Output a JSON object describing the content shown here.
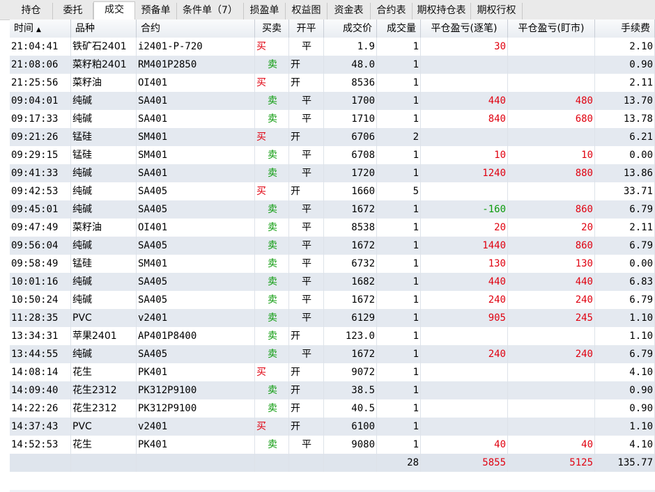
{
  "tabs": [
    "持仓",
    "委托",
    "成交",
    "预备单",
    "条件单（7）",
    "损盈单",
    "权益图",
    "资金表",
    "合约表",
    "期权持仓表",
    "期权行权"
  ],
  "active_tab": 2,
  "columns": [
    "时间",
    "品种",
    "合约",
    "买卖",
    "开平",
    "成交价",
    "成交量",
    "平仓盈亏(逐笔)",
    "平仓盈亏(盯市)",
    "手续费"
  ],
  "sort_icon": "sort-asc-icon",
  "colors": {
    "buy": "#e0000f",
    "sell": "#0a9a0a",
    "profit": "#e0000f",
    "loss": "#0a9a0a"
  },
  "trades": [
    {
      "time": "21:04:41",
      "product": "铁矿石2401",
      "contract": "i2401-P-720",
      "side": "买",
      "oc": "平",
      "price": "1.9",
      "qty": "1",
      "pnl_trade": "30",
      "pnl_mtm": "",
      "fee": "2.10"
    },
    {
      "time": "21:08:06",
      "product": "菜籽粕2401",
      "contract": "RM401P2850",
      "side": "卖",
      "oc": "开",
      "price": "48.0",
      "qty": "1",
      "pnl_trade": "",
      "pnl_mtm": "",
      "fee": "0.90"
    },
    {
      "time": "21:25:56",
      "product": "菜籽油",
      "contract": "OI401",
      "side": "买",
      "oc": "开",
      "price": "8536",
      "qty": "1",
      "pnl_trade": "",
      "pnl_mtm": "",
      "fee": "2.11"
    },
    {
      "time": "09:04:01",
      "product": "纯碱",
      "contract": "SA401",
      "side": "卖",
      "oc": "平",
      "price": "1700",
      "qty": "1",
      "pnl_trade": "440",
      "pnl_mtm": "480",
      "fee": "13.70"
    },
    {
      "time": "09:17:33",
      "product": "纯碱",
      "contract": "SA401",
      "side": "卖",
      "oc": "平",
      "price": "1710",
      "qty": "1",
      "pnl_trade": "840",
      "pnl_mtm": "680",
      "fee": "13.78"
    },
    {
      "time": "09:21:26",
      "product": "锰硅",
      "contract": "SM401",
      "side": "买",
      "oc": "开",
      "price": "6706",
      "qty": "2",
      "pnl_trade": "",
      "pnl_mtm": "",
      "fee": "6.21"
    },
    {
      "time": "09:29:15",
      "product": "锰硅",
      "contract": "SM401",
      "side": "卖",
      "oc": "平",
      "price": "6708",
      "qty": "1",
      "pnl_trade": "10",
      "pnl_mtm": "10",
      "fee": "0.00"
    },
    {
      "time": "09:41:33",
      "product": "纯碱",
      "contract": "SA401",
      "side": "卖",
      "oc": "平",
      "price": "1720",
      "qty": "1",
      "pnl_trade": "1240",
      "pnl_mtm": "880",
      "fee": "13.86"
    },
    {
      "time": "09:42:53",
      "product": "纯碱",
      "contract": "SA405",
      "side": "买",
      "oc": "开",
      "price": "1660",
      "qty": "5",
      "pnl_trade": "",
      "pnl_mtm": "",
      "fee": "33.71"
    },
    {
      "time": "09:45:01",
      "product": "纯碱",
      "contract": "SA405",
      "side": "卖",
      "oc": "平",
      "price": "1672",
      "qty": "1",
      "pnl_trade": "-160",
      "pnl_mtm": "860",
      "fee": "6.79"
    },
    {
      "time": "09:47:49",
      "product": "菜籽油",
      "contract": "OI401",
      "side": "卖",
      "oc": "平",
      "price": "8538",
      "qty": "1",
      "pnl_trade": "20",
      "pnl_mtm": "20",
      "fee": "2.11"
    },
    {
      "time": "09:56:04",
      "product": "纯碱",
      "contract": "SA405",
      "side": "卖",
      "oc": "平",
      "price": "1672",
      "qty": "1",
      "pnl_trade": "1440",
      "pnl_mtm": "860",
      "fee": "6.79"
    },
    {
      "time": "09:58:49",
      "product": "锰硅",
      "contract": "SM401",
      "side": "卖",
      "oc": "平",
      "price": "6732",
      "qty": "1",
      "pnl_trade": "130",
      "pnl_mtm": "130",
      "fee": "0.00"
    },
    {
      "time": "10:01:16",
      "product": "纯碱",
      "contract": "SA405",
      "side": "卖",
      "oc": "平",
      "price": "1682",
      "qty": "1",
      "pnl_trade": "440",
      "pnl_mtm": "440",
      "fee": "6.83"
    },
    {
      "time": "10:50:24",
      "product": "纯碱",
      "contract": "SA405",
      "side": "卖",
      "oc": "平",
      "price": "1672",
      "qty": "1",
      "pnl_trade": "240",
      "pnl_mtm": "240",
      "fee": "6.79"
    },
    {
      "time": "11:28:35",
      "product": "PVC",
      "contract": "v2401",
      "side": "卖",
      "oc": "平",
      "price": "6129",
      "qty": "1",
      "pnl_trade": "905",
      "pnl_mtm": "245",
      "fee": "1.10"
    },
    {
      "time": "13:34:31",
      "product": "苹果2401",
      "contract": "AP401P8400",
      "side": "卖",
      "oc": "开",
      "price": "123.0",
      "qty": "1",
      "pnl_trade": "",
      "pnl_mtm": "",
      "fee": "1.10"
    },
    {
      "time": "13:44:55",
      "product": "纯碱",
      "contract": "SA405",
      "side": "卖",
      "oc": "平",
      "price": "1672",
      "qty": "1",
      "pnl_trade": "240",
      "pnl_mtm": "240",
      "fee": "6.79"
    },
    {
      "time": "14:08:14",
      "product": "花生",
      "contract": "PK401",
      "side": "买",
      "oc": "开",
      "price": "9072",
      "qty": "1",
      "pnl_trade": "",
      "pnl_mtm": "",
      "fee": "4.10"
    },
    {
      "time": "14:09:40",
      "product": "花生2312",
      "contract": "PK312P9100",
      "side": "卖",
      "oc": "开",
      "price": "38.5",
      "qty": "1",
      "pnl_trade": "",
      "pnl_mtm": "",
      "fee": "0.90"
    },
    {
      "time": "14:22:26",
      "product": "花生2312",
      "contract": "PK312P9100",
      "side": "卖",
      "oc": "开",
      "price": "40.5",
      "qty": "1",
      "pnl_trade": "",
      "pnl_mtm": "",
      "fee": "0.90"
    },
    {
      "time": "14:37:43",
      "product": "PVC",
      "contract": "v2401",
      "side": "买",
      "oc": "开",
      "price": "6100",
      "qty": "1",
      "pnl_trade": "",
      "pnl_mtm": "",
      "fee": "1.10"
    },
    {
      "time": "14:52:53",
      "product": "花生",
      "contract": "PK401",
      "side": "卖",
      "oc": "平",
      "price": "9080",
      "qty": "1",
      "pnl_trade": "40",
      "pnl_mtm": "40",
      "fee": "4.10"
    }
  ],
  "totals": {
    "qty": "28",
    "pnl_trade": "5855",
    "pnl_mtm": "5125",
    "fee": "135.77"
  }
}
